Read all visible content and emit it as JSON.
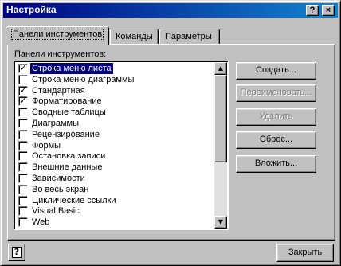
{
  "window": {
    "title": "Настройка"
  },
  "caption_buttons": {
    "help": "?",
    "close": "×"
  },
  "tabs": [
    {
      "label": "Панели инструментов",
      "active": true
    },
    {
      "label": "Команды",
      "active": false
    },
    {
      "label": "Параметры",
      "active": false
    }
  ],
  "list_label": "Панели инструментов:",
  "toolbars": [
    {
      "label": "Строка меню листа",
      "checked": true,
      "selected": true
    },
    {
      "label": "Строка меню диаграммы",
      "checked": false,
      "selected": false
    },
    {
      "label": "Стандартная",
      "checked": true,
      "selected": false
    },
    {
      "label": "Форматирование",
      "checked": true,
      "selected": false
    },
    {
      "label": "Сводные таблицы",
      "checked": false,
      "selected": false
    },
    {
      "label": "Диаграммы",
      "checked": false,
      "selected": false
    },
    {
      "label": "Рецензирование",
      "checked": false,
      "selected": false
    },
    {
      "label": "Формы",
      "checked": false,
      "selected": false
    },
    {
      "label": "Остановка записи",
      "checked": false,
      "selected": false
    },
    {
      "label": "Внешние данные",
      "checked": false,
      "selected": false
    },
    {
      "label": "Зависимости",
      "checked": false,
      "selected": false
    },
    {
      "label": "Во весь экран",
      "checked": false,
      "selected": false
    },
    {
      "label": "Циклические ссылки",
      "checked": false,
      "selected": false
    },
    {
      "label": "Visual Basic",
      "checked": false,
      "selected": false
    },
    {
      "label": "Web",
      "checked": false,
      "selected": false
    }
  ],
  "buttons": {
    "create": "Создать...",
    "rename": "Переименовать...",
    "delete": "Удалить",
    "reset": "Сброс...",
    "attach": "Вложить...",
    "close": "Закрыть"
  },
  "scrollbar": {
    "up_arrow": "▲",
    "down_arrow": "▼"
  },
  "help_glyph": "?",
  "check_glyph": "✓"
}
